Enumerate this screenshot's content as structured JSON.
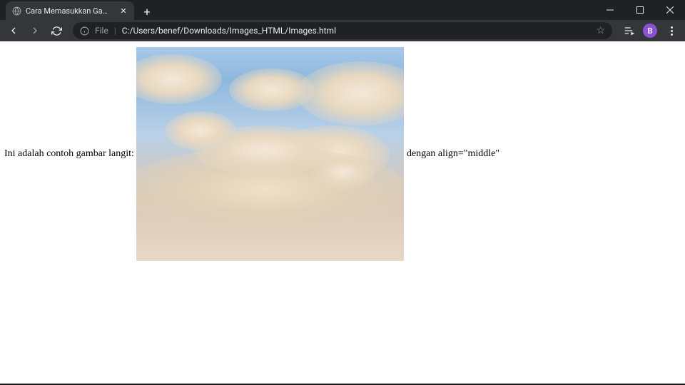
{
  "tab": {
    "title": "Cara Memasukkan Gambar di HT"
  },
  "address": {
    "scheme_label": "File",
    "path": "C:/Users/benef/Downloads/Images_HTML/Images.html"
  },
  "profile": {
    "initial": "B"
  },
  "page": {
    "text_before": "Ini adalah contoh gambar langit: ",
    "text_after": " dengan align=\"middle\""
  }
}
